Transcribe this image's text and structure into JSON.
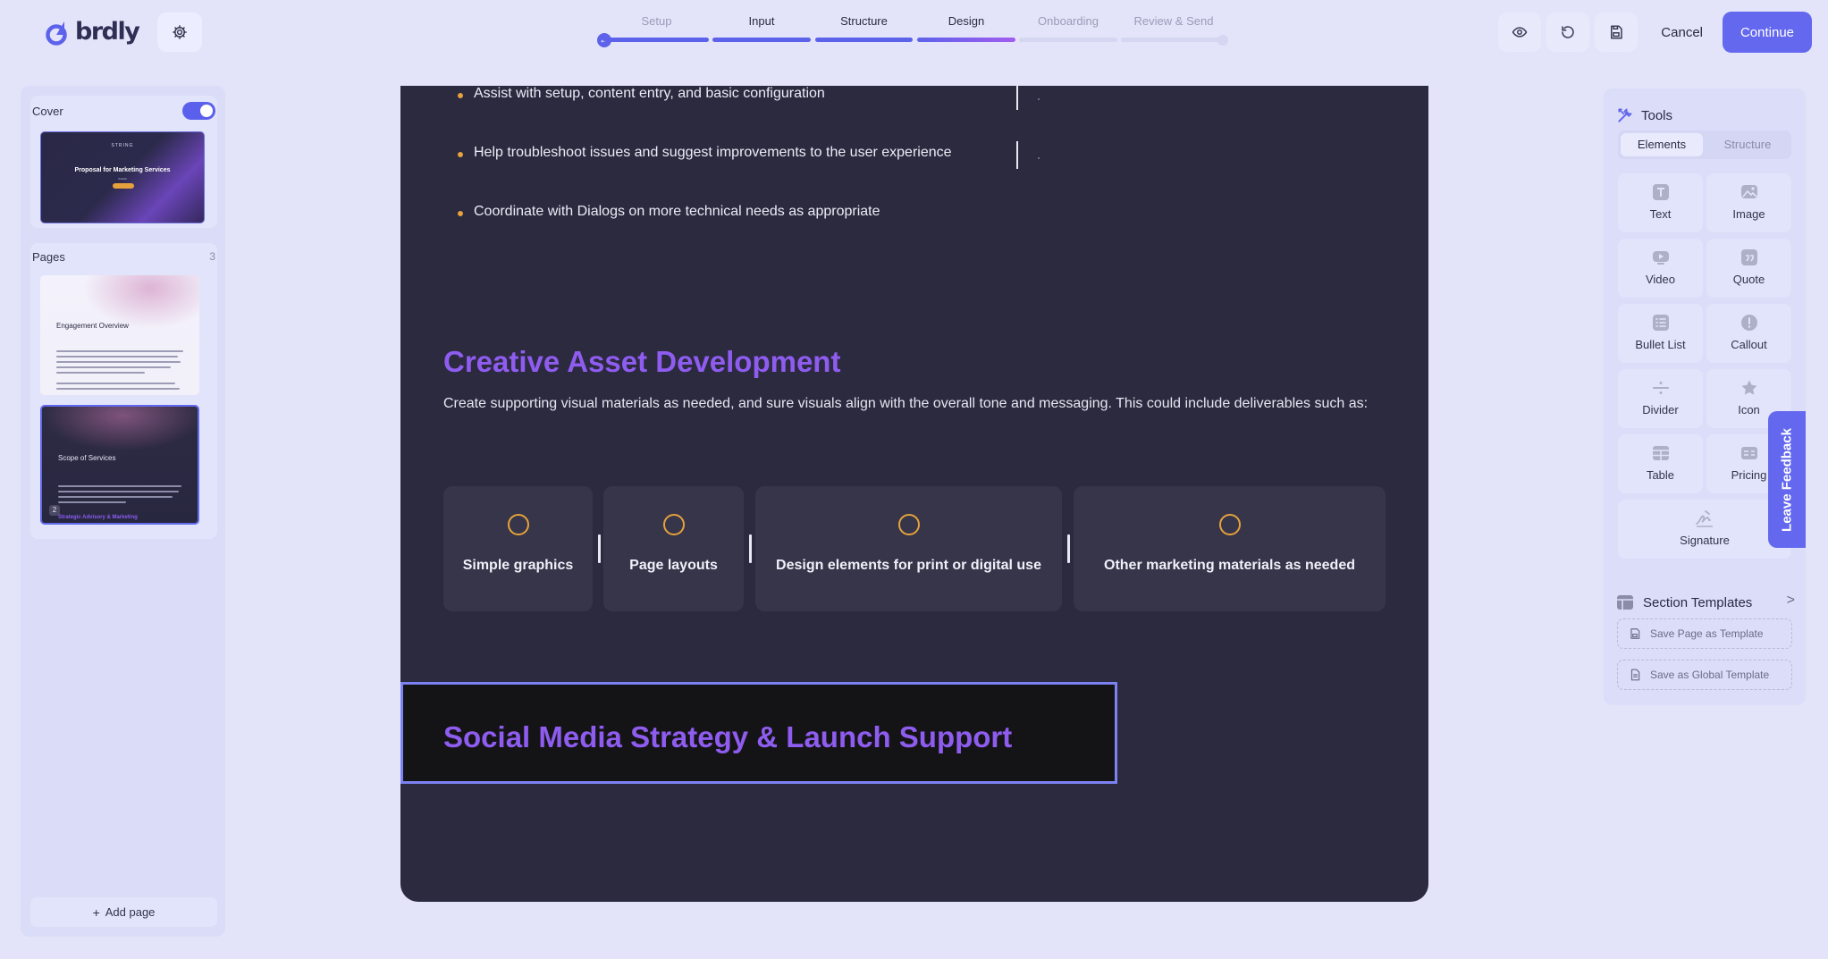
{
  "app": {
    "logo_text": "brdly",
    "colors": {
      "accent": "#6368ee",
      "heading": "#8f5cf0",
      "bullet": "#e6a23c",
      "canvas": "#2b2a3f"
    }
  },
  "steps": [
    {
      "label": "Setup",
      "state": "complete"
    },
    {
      "label": "Input",
      "state": "complete"
    },
    {
      "label": "Structure",
      "state": "complete"
    },
    {
      "label": "Design",
      "state": "active"
    },
    {
      "label": "Onboarding",
      "state": "upcoming"
    },
    {
      "label": "Review & Send",
      "state": "upcoming"
    }
  ],
  "top_actions": {
    "cancel": "Cancel",
    "continue": "Continue",
    "icons": [
      "eye-icon",
      "undo-icon",
      "save-icon"
    ]
  },
  "sidebar": {
    "cover": {
      "label": "Cover",
      "enabled": true,
      "thumb_brand": "STRING",
      "thumb_title": "Proposal for Marketing Services",
      "thumb_sub": "Subtitle"
    },
    "pages": {
      "label": "Pages",
      "count": "3",
      "items": [
        {
          "title": "Engagement Overview"
        },
        {
          "title": "Scope of Services",
          "number": "2",
          "footer": "Strategic Advisory & Marketing"
        }
      ]
    },
    "add_page": "Add page"
  },
  "canvas": {
    "bullets": [
      "Assist with setup, content entry, and basic configuration",
      "Help troubleshoot issues and suggest improvements to the user experience",
      "Coordinate with Dialogs on more technical needs as appropriate"
    ],
    "section1": {
      "title": "Creative Asset Development",
      "body": "Create supporting visual materials as needed, and sure visuals align with the overall tone and messaging. This could include deliverables such as:"
    },
    "cards": [
      "Simple graphics",
      "Page layouts",
      "Design elements for print or digital use",
      "Other marketing materials as needed"
    ],
    "section2": {
      "title": "Social Media Strategy & Launch Support"
    }
  },
  "tools": {
    "title": "Tools",
    "tabs": [
      "Elements",
      "Structure"
    ],
    "active_tab": "Elements",
    "elements": [
      {
        "label": "Text",
        "icon": "text-icon"
      },
      {
        "label": "Image",
        "icon": "image-icon"
      },
      {
        "label": "Video",
        "icon": "video-icon"
      },
      {
        "label": "Quote",
        "icon": "quote-icon"
      },
      {
        "label": "Bullet List",
        "icon": "bullet-list-icon"
      },
      {
        "label": "Callout",
        "icon": "callout-icon"
      },
      {
        "label": "Divider",
        "icon": "divider-icon"
      },
      {
        "label": "Icon",
        "icon": "star-icon"
      },
      {
        "label": "Table",
        "icon": "table-icon"
      },
      {
        "label": "Pricing",
        "icon": "pricing-icon"
      },
      {
        "label": "Signature",
        "icon": "signature-icon"
      }
    ]
  },
  "templates": {
    "title": "Section Templates",
    "chevron": ">",
    "save_page": "Save Page as Template",
    "save_global": "Save as Global Template"
  },
  "feedback": {
    "label": "Leave Feedback"
  }
}
